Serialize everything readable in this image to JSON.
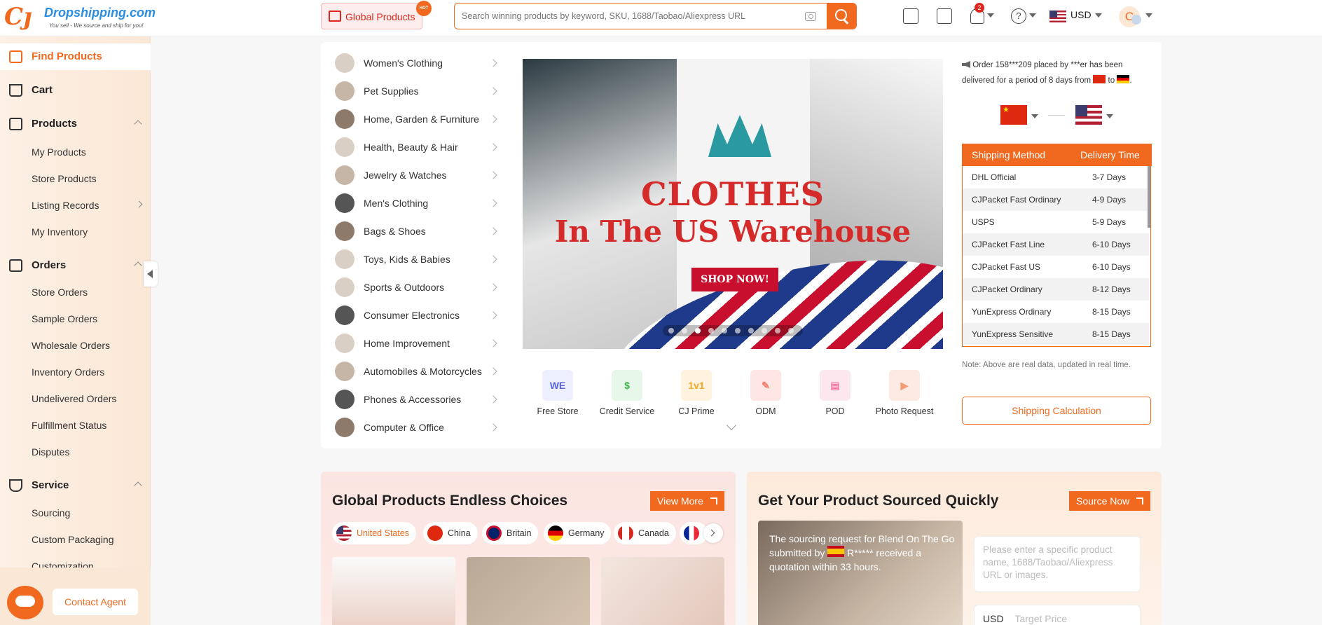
{
  "header": {
    "logo_name": "Dropshipping.com",
    "logo_tagline": "You sell - We source and ship for you!",
    "global_products_label": "Global Products",
    "hot_badge": "HOT",
    "search_placeholder": "Search winning products by keyword, SKU, 1688/Taobao/Aliexpress URL",
    "notification_count": "2",
    "currency": "USD",
    "avatar_letter": "C",
    "accent_color": "#f0691f"
  },
  "sidebar": {
    "find_products": "Find Products",
    "cart": "Cart",
    "products": {
      "label": "Products",
      "items": [
        "My Products",
        "Store Products",
        "Listing Records",
        "My Inventory"
      ]
    },
    "orders": {
      "label": "Orders",
      "items": [
        "Store Orders",
        "Sample Orders",
        "Wholesale Orders",
        "Inventory Orders",
        "Undelivered Orders",
        "Fulfillment Status",
        "Disputes"
      ]
    },
    "service": {
      "label": "Service",
      "items": [
        "Sourcing",
        "Custom Packaging",
        "Customization"
      ]
    },
    "contact_agent": "Contact Agent"
  },
  "categories": [
    "Women's Clothing",
    "Pet Supplies",
    "Home, Garden & Furniture",
    "Health, Beauty & Hair",
    "Jewelry & Watches",
    "Men's Clothing",
    "Bags & Shoes",
    "Toys, Kids & Babies",
    "Sports & Outdoors",
    "Consumer Electronics",
    "Home Improvement",
    "Automobiles & Motorcycles",
    "Phones & Accessories",
    "Computer & Office"
  ],
  "banner": {
    "title_line1": "CLOTHES",
    "title_line2": "In The US Warehouse",
    "cta": "SHOP NOW!",
    "slide_count": 10,
    "active_slide": 3
  },
  "services": [
    {
      "label": "Free Store",
      "icon": "we-icon",
      "color": "#5b63e6",
      "bg": "#eef0ff",
      "glyph": "WE"
    },
    {
      "label": "Credit Service",
      "icon": "credit-icon",
      "color": "#3bb54a",
      "bg": "#e7f7e9",
      "glyph": "$"
    },
    {
      "label": "CJ Prime",
      "icon": "diamond-icon",
      "color": "#f5a623",
      "bg": "#fff3e0",
      "glyph": "1v1"
    },
    {
      "label": "ODM",
      "icon": "ruler-icon",
      "color": "#f07a6a",
      "bg": "#fde6e3",
      "glyph": "✎"
    },
    {
      "label": "POD",
      "icon": "document-icon",
      "color": "#f27aa6",
      "bg": "#fde7ef",
      "glyph": "▤"
    },
    {
      "label": "Photo Request",
      "icon": "video-icon",
      "color": "#f59a72",
      "bg": "#fdeae2",
      "glyph": "▶"
    }
  ],
  "order_notice": {
    "text_before": "Order 158***209 placed by ***er has been delivered for a period of 8 days from",
    "text_mid": "to"
  },
  "shipping": {
    "header_method": "Shipping Method",
    "header_time": "Delivery Time",
    "rows": [
      {
        "method": "DHL Official",
        "time": "3-7 Days"
      },
      {
        "method": "CJPacket Fast Ordinary",
        "time": "4-9 Days"
      },
      {
        "method": "USPS",
        "time": "5-9 Days"
      },
      {
        "method": "CJPacket Fast Line",
        "time": "6-10 Days"
      },
      {
        "method": "CJPacket Fast US",
        "time": "6-10 Days"
      },
      {
        "method": "CJPacket Ordinary",
        "time": "8-12 Days"
      },
      {
        "method": "YunExpress Ordinary",
        "time": "8-15 Days"
      },
      {
        "method": "YunExpress Sensitive",
        "time": "8-15 Days"
      }
    ],
    "note": "Note: Above are real data, updated in real time.",
    "calc_button": "Shipping Calculation"
  },
  "global_card": {
    "title": "Global Products Endless Choices",
    "view_more": "View More",
    "countries": [
      "United States",
      "China",
      "Britain",
      "Germany",
      "Canada"
    ],
    "selected": "United States"
  },
  "source_card": {
    "title": "Get Your Product Sourced Quickly",
    "button": "Source Now",
    "story_line1": "The sourcing request for Blend On The Go submitted by",
    "story_user": "R*****",
    "story_line2": "received a quotation within 33 hours.",
    "input_placeholder": "Please enter a specific product name, 1688/Taobao/Aliexpress URL or images.",
    "price_currency": "USD",
    "price_placeholder": "Target Price"
  }
}
